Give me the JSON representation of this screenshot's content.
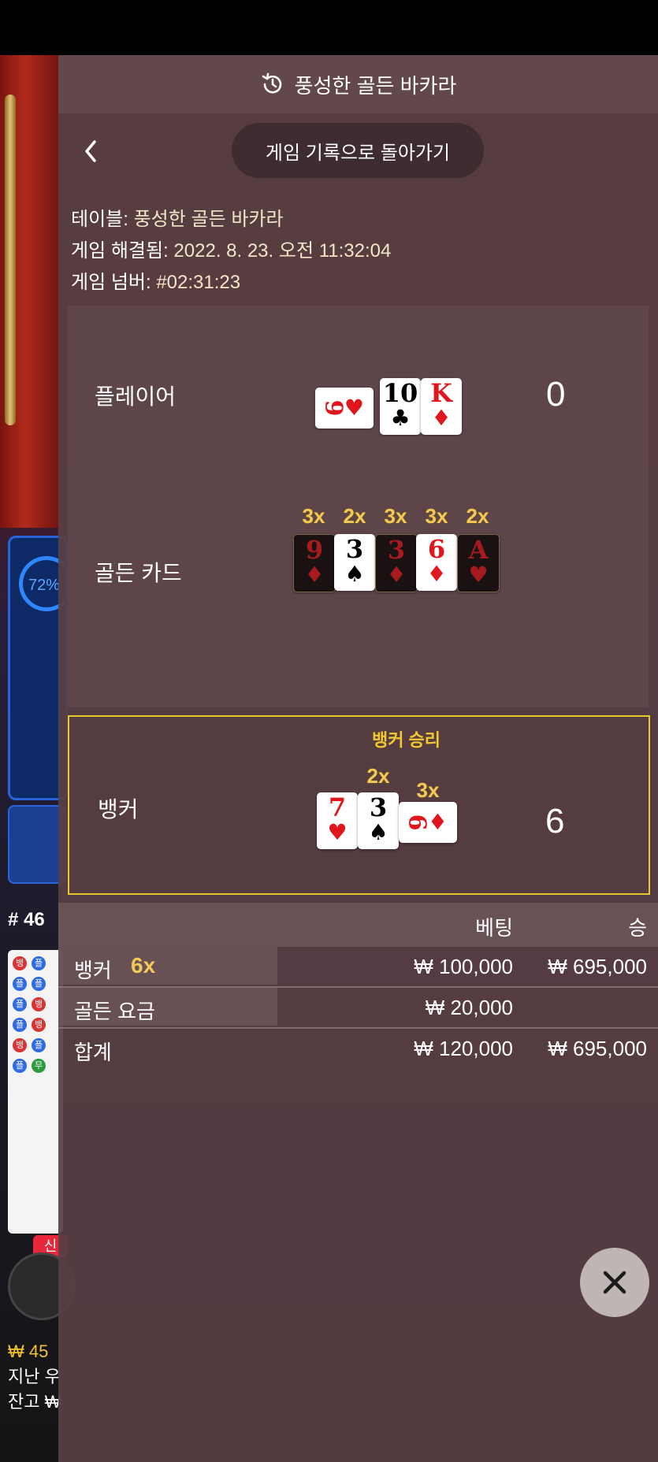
{
  "background": {
    "odds_percent": "72%",
    "round_label": "# 46",
    "roadmap": [
      {
        "t": "뱅",
        "c": "red"
      },
      {
        "t": "플",
        "c": "blue"
      },
      {
        "t": "플",
        "c": "blue"
      },
      {
        "t": "플",
        "c": "blue"
      },
      {
        "t": "플",
        "c": "blue"
      },
      {
        "t": "뱅",
        "c": "red"
      },
      {
        "t": "플",
        "c": "blue"
      },
      {
        "t": "뱅",
        "c": "red"
      },
      {
        "t": "뱅",
        "c": "red"
      },
      {
        "t": "플",
        "c": "blue"
      },
      {
        "t": "플",
        "c": "blue"
      },
      {
        "t": "무",
        "c": "green"
      }
    ],
    "new_badge": "신",
    "footer_win": "₩ 45",
    "footer_last": "지난 우",
    "footer_balance": "잔고 ₩"
  },
  "panel": {
    "title": "풍성한 골든 바카라",
    "back_label": "게임 기록으로 돌아가기",
    "meta": {
      "table_label": "테이블:",
      "table_value": "풍성한 골든 바카라",
      "resolved_label": "게임 해결됨:",
      "resolved_value": "2022. 8. 23. 오전 11:32:04",
      "number_label": "게임 넘버:",
      "number_value": "#02:31:23"
    },
    "player": {
      "label": "플레이어",
      "total": "0",
      "cards": [
        {
          "rank": "9",
          "suit": "♥",
          "color": "red",
          "side": true
        },
        {
          "rank": "10",
          "suit": "♣",
          "color": "black"
        },
        {
          "rank": "K",
          "suit": "♦",
          "color": "red"
        }
      ]
    },
    "golden": {
      "label": "골든 카드",
      "cards": [
        {
          "rank": "9",
          "suit": "♦",
          "color": "red",
          "mult": "3x",
          "dark": true
        },
        {
          "rank": "3",
          "suit": "♠",
          "color": "black",
          "mult": "2x",
          "dark": false
        },
        {
          "rank": "3",
          "suit": "♦",
          "color": "red",
          "mult": "3x",
          "dark": true
        },
        {
          "rank": "6",
          "suit": "♦",
          "color": "red",
          "mult": "3x",
          "dark": false
        },
        {
          "rank": "A",
          "suit": "♥",
          "color": "red",
          "mult": "2x",
          "dark": true
        }
      ]
    },
    "banker": {
      "label": "뱅커",
      "win_text": "뱅커 승리",
      "total": "6",
      "cards": [
        {
          "rank": "7",
          "suit": "♥",
          "color": "red",
          "mult": ""
        },
        {
          "rank": "3",
          "suit": "♠",
          "color": "black",
          "mult": "2x"
        },
        {
          "rank": "6",
          "suit": "♦",
          "color": "red",
          "mult": "3x",
          "side": true
        }
      ]
    },
    "bets": {
      "header_bet": "베팅",
      "header_win": "승",
      "rows": [
        {
          "name": "뱅커",
          "mult": "6x",
          "amount": "₩ 100,000",
          "win": "₩ 695,000"
        },
        {
          "name": "골든 요금",
          "mult": "",
          "amount": "₩ 20,000",
          "win": ""
        }
      ],
      "total": {
        "name": "합계",
        "amount": "₩ 120,000",
        "win": "₩ 695,000"
      }
    }
  }
}
